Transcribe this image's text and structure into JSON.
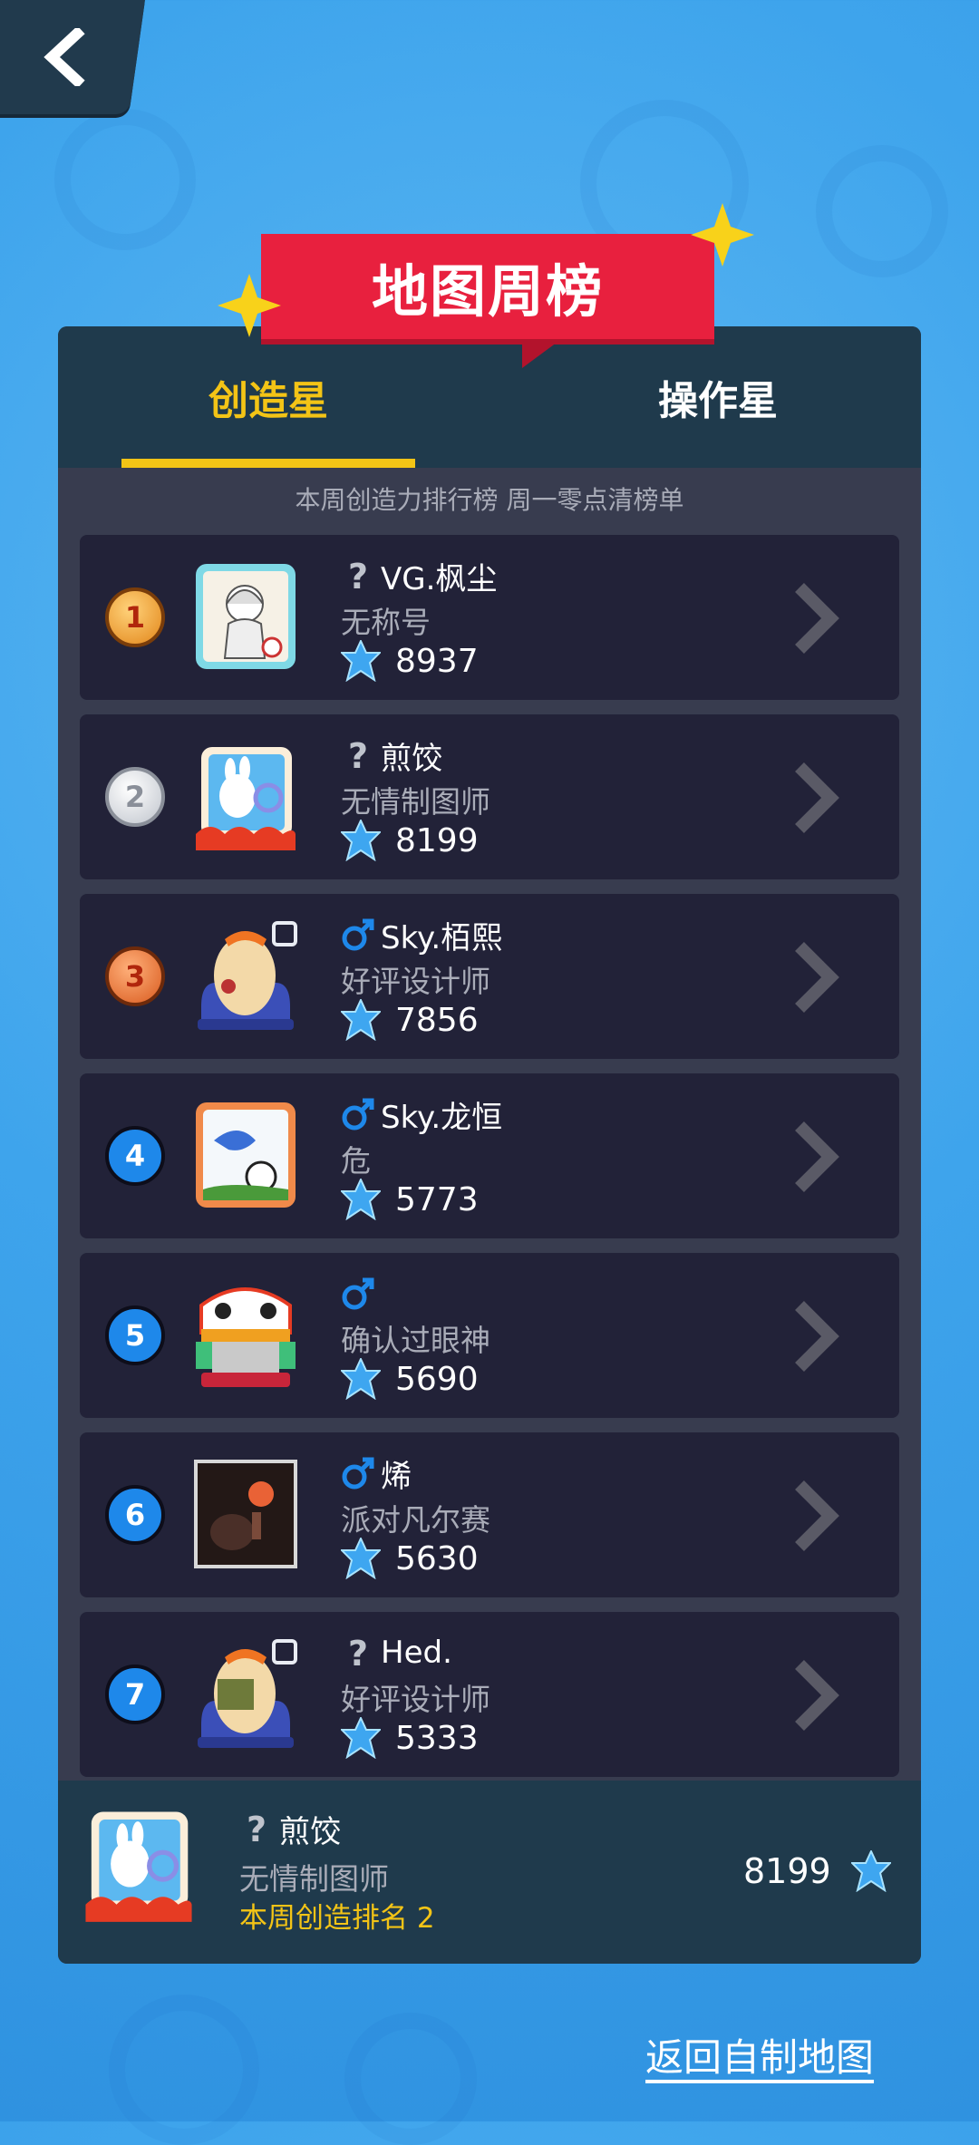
{
  "header": {
    "title": "地图周榜",
    "back_icon": "chevron-left-icon"
  },
  "tabs": [
    {
      "label": "创造星",
      "active": true
    },
    {
      "label": "操作星",
      "active": false
    }
  ],
  "subtitle": "本周创造力排行榜 周一零点清榜单",
  "colors": {
    "accent": "#f3c416",
    "ribbon": "#e8203e",
    "panel": "#383c4f",
    "row": "#222238",
    "tab_bar": "#1f3a4c",
    "male": "#1e88ea"
  },
  "rankings": [
    {
      "rank": "1",
      "gender_icon": "unknown-gender-icon",
      "name": "VG.枫尘",
      "title": "无称号",
      "score": "8937"
    },
    {
      "rank": "2",
      "gender_icon": "unknown-gender-icon",
      "name": "煎饺",
      "title": "无情制图师",
      "score": "8199"
    },
    {
      "rank": "3",
      "gender_icon": "male-icon",
      "name": "Sky.栢熙",
      "title": "好评设计师",
      "score": "7856"
    },
    {
      "rank": "4",
      "gender_icon": "male-icon",
      "name": "Sky.龙恒",
      "title": "危",
      "score": "5773"
    },
    {
      "rank": "5",
      "gender_icon": "male-icon",
      "name": "",
      "title": "确认过眼神",
      "score": "5690"
    },
    {
      "rank": "6",
      "gender_icon": "male-icon",
      "name": "烯",
      "title": "派对凡尔赛",
      "score": "5630"
    },
    {
      "rank": "7",
      "gender_icon": "unknown-gender-icon",
      "name": "Hed.",
      "title": "好评设计师",
      "score": "5333"
    }
  ],
  "me": {
    "name": "煎饺",
    "title": "无情制图师",
    "rank_text": "本周创造排名 2",
    "score": "8199"
  },
  "footer_link": "返回自制地图"
}
